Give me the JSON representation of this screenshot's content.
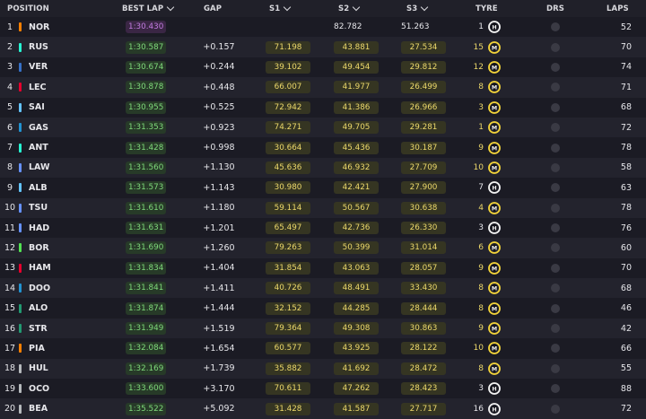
{
  "header": {
    "position": "POSITION",
    "best_lap": "BEST LAP",
    "gap": "GAP",
    "s1": "S1",
    "s2": "S2",
    "s3": "S3",
    "tyre": "TYRE",
    "drs": "DRS",
    "laps": "LAPS"
  },
  "colors": {
    "green": "#7fd97b",
    "purple": "#c27be0",
    "yellow": "#ecd86a"
  },
  "rows": [
    {
      "pos": "1",
      "team_color": "#ff8000",
      "driver": "NOR",
      "best": "1:30.430",
      "best_style": "purple",
      "gap": "",
      "s1": "",
      "s2": "82.782",
      "s3": "51.263",
      "tyre_age": "1",
      "tyre_new": false,
      "tyre": "H",
      "laps": "52",
      "s1_style": "plain",
      "s2_style": "plain",
      "s3_style": "plain"
    },
    {
      "pos": "2",
      "team_color": "#27f4d2",
      "driver": "RUS",
      "best": "1:30.587",
      "best_style": "green",
      "gap": "+0.157",
      "s1": "71.198",
      "s2": "43.881",
      "s3": "27.534",
      "tyre_age": "15",
      "tyre_new": true,
      "tyre": "M",
      "laps": "70",
      "s1_style": "yellow",
      "s2_style": "yellow",
      "s3_style": "yellow"
    },
    {
      "pos": "3",
      "team_color": "#3671c6",
      "driver": "VER",
      "best": "1:30.674",
      "best_style": "green",
      "gap": "+0.244",
      "s1": "39.102",
      "s2": "49.454",
      "s3": "29.812",
      "tyre_age": "12",
      "tyre_new": true,
      "tyre": "M",
      "laps": "74",
      "s1_style": "yellow",
      "s2_style": "yellow",
      "s3_style": "yellow"
    },
    {
      "pos": "4",
      "team_color": "#e8002d",
      "driver": "LEC",
      "best": "1:30.878",
      "best_style": "green",
      "gap": "+0.448",
      "s1": "66.007",
      "s2": "41.977",
      "s3": "26.499",
      "tyre_age": "8",
      "tyre_new": true,
      "tyre": "M",
      "laps": "71",
      "s1_style": "yellow",
      "s2_style": "yellow",
      "s3_style": "yellow"
    },
    {
      "pos": "5",
      "team_color": "#64c4ff",
      "driver": "SAI",
      "best": "1:30.955",
      "best_style": "green",
      "gap": "+0.525",
      "s1": "72.942",
      "s2": "41.386",
      "s3": "26.966",
      "tyre_age": "3",
      "tyre_new": true,
      "tyre": "M",
      "laps": "68",
      "s1_style": "yellow",
      "s2_style": "yellow",
      "s3_style": "yellow"
    },
    {
      "pos": "6",
      "team_color": "#2293d1",
      "driver": "GAS",
      "best": "1:31.353",
      "best_style": "green",
      "gap": "+0.923",
      "s1": "74.271",
      "s2": "49.705",
      "s3": "29.281",
      "tyre_age": "1",
      "tyre_new": true,
      "tyre": "M",
      "laps": "72",
      "s1_style": "yellow",
      "s2_style": "yellow",
      "s3_style": "yellow"
    },
    {
      "pos": "7",
      "team_color": "#27f4d2",
      "driver": "ANT",
      "best": "1:31.428",
      "best_style": "green",
      "gap": "+0.998",
      "s1": "30.664",
      "s2": "45.436",
      "s3": "30.187",
      "tyre_age": "9",
      "tyre_new": true,
      "tyre": "M",
      "laps": "78",
      "s1_style": "yellow",
      "s2_style": "yellow",
      "s3_style": "yellow"
    },
    {
      "pos": "8",
      "team_color": "#6692ff",
      "driver": "LAW",
      "best": "1:31.560",
      "best_style": "green",
      "gap": "+1.130",
      "s1": "45.636",
      "s2": "46.932",
      "s3": "27.709",
      "tyre_age": "10",
      "tyre_new": true,
      "tyre": "M",
      "laps": "58",
      "s1_style": "yellow",
      "s2_style": "yellow",
      "s3_style": "yellow"
    },
    {
      "pos": "9",
      "team_color": "#64c4ff",
      "driver": "ALB",
      "best": "1:31.573",
      "best_style": "green",
      "gap": "+1.143",
      "s1": "30.980",
      "s2": "42.421",
      "s3": "27.900",
      "tyre_age": "7",
      "tyre_new": false,
      "tyre": "H",
      "laps": "63",
      "s1_style": "yellow",
      "s2_style": "yellow",
      "s3_style": "yellow"
    },
    {
      "pos": "10",
      "team_color": "#6692ff",
      "driver": "TSU",
      "best": "1:31.610",
      "best_style": "green",
      "gap": "+1.180",
      "s1": "59.114",
      "s2": "50.567",
      "s3": "30.638",
      "tyre_age": "4",
      "tyre_new": true,
      "tyre": "M",
      "laps": "78",
      "s1_style": "yellow",
      "s2_style": "yellow",
      "s3_style": "yellow"
    },
    {
      "pos": "11",
      "team_color": "#6692ff",
      "driver": "HAD",
      "best": "1:31.631",
      "best_style": "green",
      "gap": "+1.201",
      "s1": "65.497",
      "s2": "42.736",
      "s3": "26.330",
      "tyre_age": "3",
      "tyre_new": false,
      "tyre": "H",
      "laps": "76",
      "s1_style": "yellow",
      "s2_style": "yellow",
      "s3_style": "yellow"
    },
    {
      "pos": "12",
      "team_color": "#52e252",
      "driver": "BOR",
      "best": "1:31.690",
      "best_style": "green",
      "gap": "+1.260",
      "s1": "79.263",
      "s2": "50.399",
      "s3": "31.014",
      "tyre_age": "6",
      "tyre_new": true,
      "tyre": "M",
      "laps": "60",
      "s1_style": "yellow",
      "s2_style": "yellow",
      "s3_style": "yellow"
    },
    {
      "pos": "13",
      "team_color": "#e8002d",
      "driver": "HAM",
      "best": "1:31.834",
      "best_style": "green",
      "gap": "+1.404",
      "s1": "31.854",
      "s2": "43.063",
      "s3": "28.057",
      "tyre_age": "9",
      "tyre_new": true,
      "tyre": "M",
      "laps": "70",
      "s1_style": "yellow",
      "s2_style": "yellow",
      "s3_style": "yellow"
    },
    {
      "pos": "14",
      "team_color": "#2293d1",
      "driver": "DOO",
      "best": "1:31.841",
      "best_style": "green",
      "gap": "+1.411",
      "s1": "40.726",
      "s2": "48.491",
      "s3": "33.430",
      "tyre_age": "8",
      "tyre_new": true,
      "tyre": "M",
      "laps": "68",
      "s1_style": "yellow",
      "s2_style": "yellow",
      "s3_style": "yellow"
    },
    {
      "pos": "15",
      "team_color": "#229971",
      "driver": "ALO",
      "best": "1:31.874",
      "best_style": "green",
      "gap": "+1.444",
      "s1": "32.152",
      "s2": "44.285",
      "s3": "28.444",
      "tyre_age": "8",
      "tyre_new": true,
      "tyre": "M",
      "laps": "46",
      "s1_style": "yellow",
      "s2_style": "yellow",
      "s3_style": "yellow"
    },
    {
      "pos": "16",
      "team_color": "#229971",
      "driver": "STR",
      "best": "1:31.949",
      "best_style": "green",
      "gap": "+1.519",
      "s1": "79.364",
      "s2": "49.308",
      "s3": "30.863",
      "tyre_age": "9",
      "tyre_new": true,
      "tyre": "M",
      "laps": "42",
      "s1_style": "yellow",
      "s2_style": "yellow",
      "s3_style": "yellow"
    },
    {
      "pos": "17",
      "team_color": "#ff8000",
      "driver": "PIA",
      "best": "1:32.084",
      "best_style": "green",
      "gap": "+1.654",
      "s1": "60.577",
      "s2": "43.925",
      "s3": "28.122",
      "tyre_age": "10",
      "tyre_new": true,
      "tyre": "M",
      "laps": "66",
      "s1_style": "yellow",
      "s2_style": "yellow",
      "s3_style": "yellow"
    },
    {
      "pos": "18",
      "team_color": "#b6babd",
      "driver": "HUL",
      "best": "1:32.169",
      "best_style": "green",
      "gap": "+1.739",
      "s1": "35.882",
      "s2": "41.692",
      "s3": "28.472",
      "tyre_age": "8",
      "tyre_new": true,
      "tyre": "M",
      "laps": "55",
      "s1_style": "yellow",
      "s2_style": "yellow",
      "s3_style": "yellow"
    },
    {
      "pos": "19",
      "team_color": "#b6babd",
      "driver": "OCO",
      "best": "1:33.600",
      "best_style": "green",
      "gap": "+3.170",
      "s1": "70.611",
      "s2": "47.262",
      "s3": "28.423",
      "tyre_age": "3",
      "tyre_new": false,
      "tyre": "H",
      "laps": "88",
      "s1_style": "yellow",
      "s2_style": "yellow",
      "s3_style": "yellow"
    },
    {
      "pos": "20",
      "team_color": "#b6babd",
      "driver": "BEA",
      "best": "1:35.522",
      "best_style": "green",
      "gap": "+5.092",
      "s1": "31.428",
      "s2": "41.587",
      "s3": "27.717",
      "tyre_age": "16",
      "tyre_new": false,
      "tyre": "H",
      "laps": "72",
      "s1_style": "yellow",
      "s2_style": "yellow",
      "s3_style": "yellow"
    }
  ]
}
